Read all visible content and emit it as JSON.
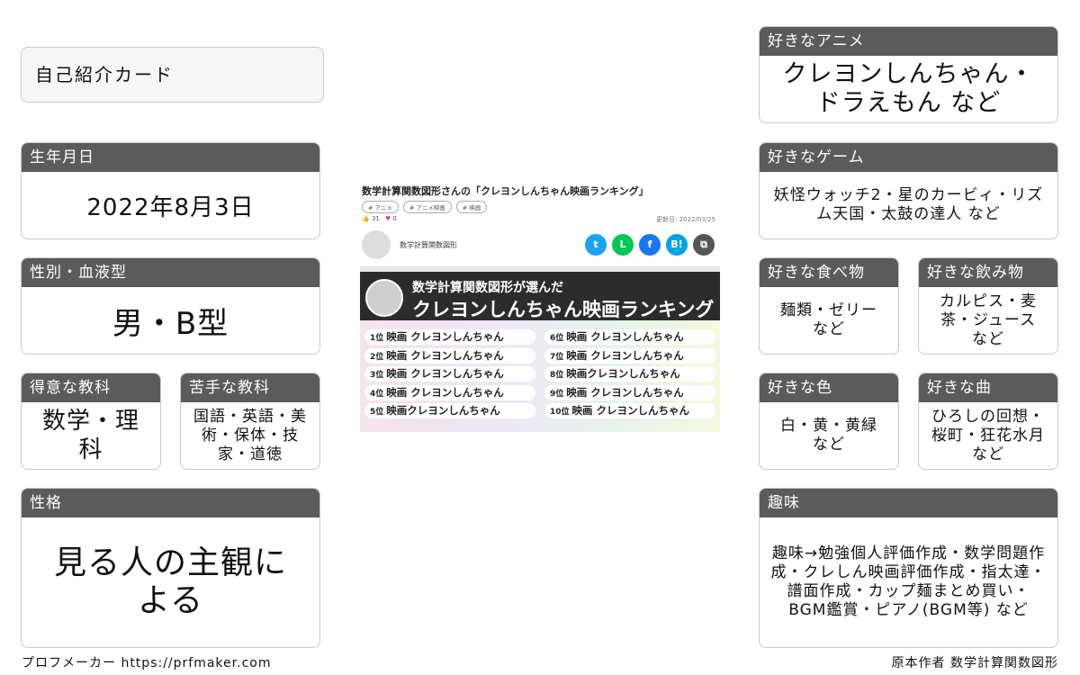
{
  "title_card": "自己紹介カード",
  "birthday": {
    "label": "生年月日",
    "value": "2022年8月3日"
  },
  "gender_blood": {
    "label": "性別・血液型",
    "value": "男・B型"
  },
  "good_subject": {
    "label": "得意な教科",
    "value": "数学・理科"
  },
  "bad_subject": {
    "label": "苦手な教科",
    "value": "国語・英語・美術・保体・技家・道徳"
  },
  "personality": {
    "label": "性格",
    "value": "見る人の主観による"
  },
  "fav_anime": {
    "label": "好きなアニメ",
    "value": "クレヨンしんちゃん・ドラえもん など"
  },
  "fav_game": {
    "label": "好きなゲーム",
    "value": "妖怪ウォッチ2・星のカービィ・リズム天国・太鼓の達人 など"
  },
  "fav_food": {
    "label": "好きな食べ物",
    "value": "麺類・ゼリー など"
  },
  "fav_drink": {
    "label": "好きな飲み物",
    "value": "カルピス・麦茶・ジュース など"
  },
  "fav_color": {
    "label": "好きな色",
    "value": "白・黄・黄緑 など"
  },
  "fav_song": {
    "label": "好きな曲",
    "value": "ひろしの回想・桜町・狂花水月 など"
  },
  "hobby": {
    "label": "趣味",
    "value": "趣味→勉強個人評価作成・数学問題作成・クレしん映画評価作成・指太達・譜面作成・カップ麺まとめ買い・BGM鑑賞・ピアノ(BGM等) など"
  },
  "footer": {
    "left": "プロフメーカー https://prfmaker.com",
    "right": "原本作者 数学計算関数図形"
  },
  "article": {
    "title": "数学計算関数図形さんの「クレヨンしんちゃん映画ランキング」",
    "tags": [
      "# アニメ",
      "# アニメ映画",
      "# 映画"
    ],
    "likes": "31",
    "hearts": "0",
    "updated": "更新日: 2022/03/25",
    "author": "数学計算関数図形",
    "share_icons": [
      {
        "name": "twitter-icon",
        "glyph": "t",
        "color": "#1da1f2"
      },
      {
        "name": "line-icon",
        "glyph": "L",
        "color": "#06c755"
      },
      {
        "name": "facebook-icon",
        "glyph": "f",
        "color": "#1877f2"
      },
      {
        "name": "hatena-icon",
        "glyph": "B!",
        "color": "#00a4de"
      },
      {
        "name": "copy-icon",
        "glyph": "⧉",
        "color": "#555555"
      }
    ],
    "banner_line1": "数学計算関数図形が選んだ",
    "banner_line2": "クレヨンしんちゃん映画ランキング",
    "ranks": [
      {
        "n": "1位",
        "t": "映画 クレヨンしんちゃん"
      },
      {
        "n": "2位",
        "t": "映画 クレヨンしんちゃん"
      },
      {
        "n": "3位",
        "t": "映画 クレヨンしんちゃん"
      },
      {
        "n": "4位",
        "t": "映画 クレヨンしんちゃん"
      },
      {
        "n": "5位",
        "t": "映画クレヨンしんちゃん"
      },
      {
        "n": "6位",
        "t": "映画 クレヨンしんちゃん"
      },
      {
        "n": "7位",
        "t": "映画 クレヨンしんちゃん"
      },
      {
        "n": "8位",
        "t": "映画クレヨンしんちゃん"
      },
      {
        "n": "9位",
        "t": "映画 クレヨンしんちゃん"
      },
      {
        "n": "10位",
        "t": "映画 クレヨンしんちゃん"
      }
    ]
  }
}
